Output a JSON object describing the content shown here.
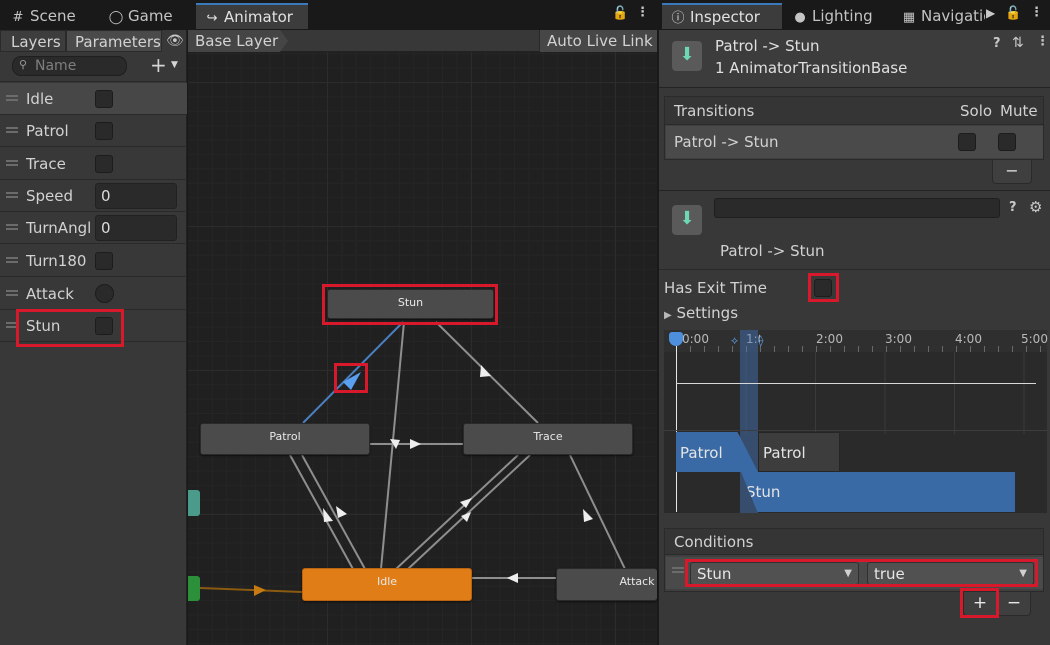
{
  "left_tabs": {
    "scene": "Scene",
    "game": "Game",
    "animator": "Animator"
  },
  "animator": {
    "subtab_layers": "Layers",
    "subtab_parameters": "Parameters",
    "search_placeholder": "Name",
    "breadcrumb": "Base Layer",
    "auto_live_link": "Auto Live Link",
    "parameters": [
      {
        "name": "Idle",
        "type": "bool"
      },
      {
        "name": "Patrol",
        "type": "bool"
      },
      {
        "name": "Trace",
        "type": "bool"
      },
      {
        "name": "Speed",
        "type": "float",
        "value": "0"
      },
      {
        "name": "TurnAngl",
        "type": "float",
        "value": "0"
      },
      {
        "name": "Turn180",
        "type": "bool"
      },
      {
        "name": "Attack",
        "type": "trigger"
      },
      {
        "name": "Stun",
        "type": "bool"
      }
    ],
    "states": {
      "stun": "Stun",
      "patrol": "Patrol",
      "trace": "Trace",
      "idle": "Idle",
      "attack": "Attack"
    }
  },
  "inspector": {
    "tabs": {
      "inspector": "Inspector",
      "lighting": "Lighting",
      "navigation": "Navigatio"
    },
    "header_title": "Patrol -> Stun",
    "header_subtitle": "1 AnimatorTransitionBase",
    "transitions_header": "Transitions",
    "solo_label": "Solo",
    "mute_label": "Mute",
    "transition_row": "Patrol -> Stun",
    "transition_name_label": "Patrol -> Stun",
    "has_exit_time_label": "Has Exit Time",
    "has_exit_time": false,
    "settings_label": "Settings",
    "timeline_ticks": [
      "0:00",
      "1:00",
      "2:00",
      "3:00",
      "4:00",
      "5:00"
    ],
    "timeline_clip_patrol_1": "Patrol",
    "timeline_clip_patrol_2": "Patrol",
    "timeline_clip_stun": "Stun",
    "conditions_header": "Conditions",
    "condition": {
      "parameter": "Stun",
      "value": "true"
    },
    "add_label": "+",
    "remove_label": "−"
  },
  "colors": {
    "accent_blue": "#3a79bb",
    "state_orange": "#e07d16",
    "highlight_red": "#d8192b"
  }
}
